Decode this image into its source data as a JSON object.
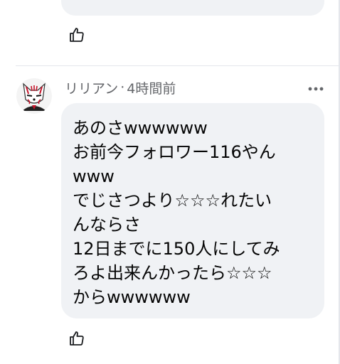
{
  "previous_comment": {
    "like_icon": "thumbs-up-icon"
  },
  "comment": {
    "author": "リリアン",
    "separator": "·",
    "time": "4時間前",
    "more_icon": "more-horizontal-icon",
    "avatar": "avatar-image",
    "lines": [
      "あのさwwwwww",
      "お前今フォロワー116やん",
      "www",
      "でじさつより☆☆☆れたい",
      "んならさ",
      "12日までに150人にしてみ",
      "ろよ出来んかったら☆☆☆",
      "からwwwwww"
    ],
    "like_icon": "thumbs-up-icon"
  },
  "colors": {
    "bubble": "#f0f2f5",
    "meta_text": "#65676b",
    "text": "#050505",
    "divider": "#e4e6eb"
  }
}
